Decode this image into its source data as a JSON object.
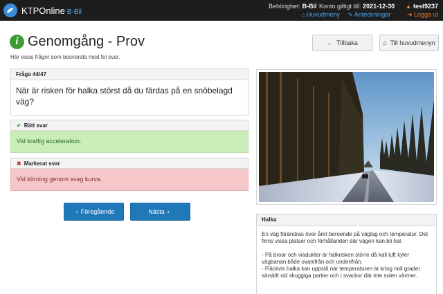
{
  "header": {
    "brand": "KTPOnline",
    "brand_sub": "B-Bil",
    "permission_label": "Behörighet:",
    "permission_value": "B-Bil",
    "valid_label": "Konto giltigt till:",
    "valid_value": "2021-12-30",
    "main_menu_link": "Huvudmeny",
    "notes_link": "Anteckningar",
    "username": "test9237",
    "logout": "Logga ut"
  },
  "page": {
    "title": "Genomgång - Prov",
    "subtitle": "Här visas frågor som besvarats med fel svar.",
    "back_button": "Tillbaka",
    "main_menu_button": "Till huvudmenyn"
  },
  "question": {
    "label": "Fråga 44/47",
    "text": "När är risken för halka störst då du färdas på en snöbelagd väg?"
  },
  "correct": {
    "label": "Rätt svar",
    "text": "Vid kraftig acceleration."
  },
  "marked": {
    "label": "Markerat svar",
    "text": "Vid körning genom svag kurva."
  },
  "nav": {
    "prev": "Föregående",
    "next": "Nästa"
  },
  "info": {
    "title": "Halka",
    "para1": "En väg förändras över året beroende på väglag och temperatur. Det finns vissa platser och förhållanden där vägen kan bli hal.",
    "item1": "- På broar och viadukter är halkrisken större då kall luft kyler vägbanan både ovanifrån och underifrån.",
    "item2": "- Fläckvis halka kan uppstå när temperaturen är kring noll grader särskilt vid skuggiga partier och i svackor där inte solen värmer."
  },
  "icons": {
    "logo": "globe-logo-icon",
    "home": "home-icon",
    "pencil": "pencil-icon",
    "user": "user-icon",
    "logout": "logout-icon",
    "info": "info-icon",
    "back": "arrow-left-icon",
    "check": "check-icon",
    "cross": "cross-icon"
  },
  "colors": {
    "topbar": "#1d1d1d",
    "link_blue": "#4aa3ea",
    "logout_orange": "#e9762b",
    "success_bg": "#c9ecb9",
    "danger_bg": "#f5c7c9",
    "primary_button": "#1f78b8"
  }
}
